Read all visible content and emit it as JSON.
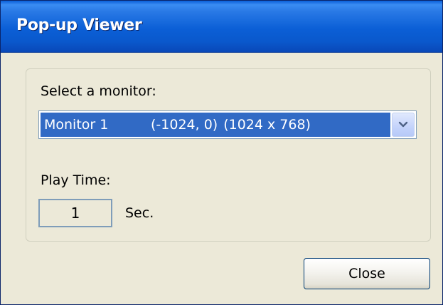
{
  "window": {
    "title": "Pop-up Viewer"
  },
  "monitor": {
    "label": "Select a monitor:",
    "selected_monitor": "Monitor 1",
    "selected_position": "(-1024, 0)",
    "selected_resolution": "(1024 x 768)",
    "dropdown_icon": "chevron-down-icon"
  },
  "play_time": {
    "label": "Play Time:",
    "value": "1",
    "unit": "Sec."
  },
  "buttons": {
    "close_label": "Close"
  },
  "colors": {
    "titlebar": "#0a5fd8",
    "selection": "#316ac5",
    "window_bg": "#ece9d8"
  }
}
